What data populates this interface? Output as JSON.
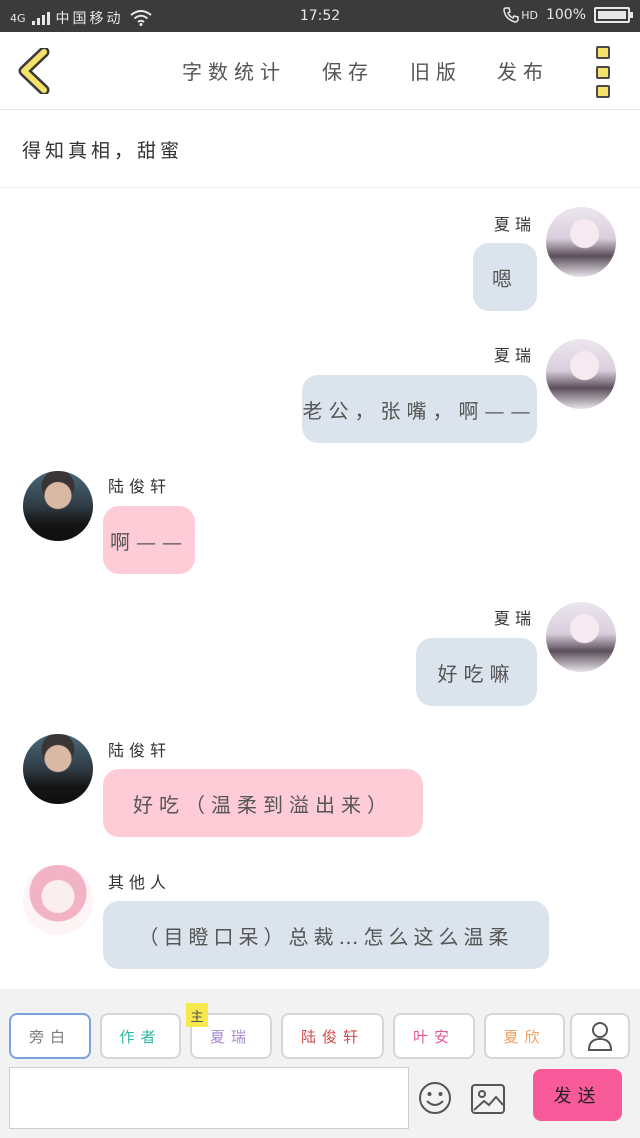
{
  "status_bar": {
    "network": "4G",
    "carrier": "中国移动",
    "time": "17:52",
    "hd": "HD",
    "battery": "100%",
    "battery_level": 1.0
  },
  "nav": {
    "word_count": "字数统计",
    "save": "保存",
    "old_version": "旧版",
    "publish": "发布"
  },
  "chapter_title": "得知真相，甜蜜",
  "messages": [
    {
      "speaker": "夏瑞",
      "side": "right",
      "text": "嗯"
    },
    {
      "speaker": "夏瑞",
      "side": "right",
      "text": "老公，张嘴，啊——"
    },
    {
      "speaker": "陆俊轩",
      "side": "left",
      "text": "啊——"
    },
    {
      "speaker": "夏瑞",
      "side": "right",
      "text": "好吃嘛"
    },
    {
      "speaker": "陆俊轩",
      "side": "left",
      "text": "好吃（温柔到溢出来）"
    },
    {
      "speaker": "其他人",
      "side": "left",
      "text": "（目瞪口呆）总裁…怎么这么温柔"
    }
  ],
  "roles": [
    {
      "label": "旁白",
      "color": "#7a7a7a"
    },
    {
      "label": "作者",
      "color": "#2fb8a6"
    },
    {
      "label": "夏瑞",
      "color": "#a88ad6"
    },
    {
      "label": "陆俊轩",
      "color": "#d54a48"
    },
    {
      "label": "叶安",
      "color": "#e35a9a"
    },
    {
      "label": "夏欣",
      "color": "#f0a060"
    }
  ],
  "main_badge": "主",
  "input": {
    "value": "",
    "placeholder": ""
  },
  "send_label": "发送",
  "icons": {
    "back": "chevron-left-icon",
    "menu": "menu-icon",
    "user": "user-icon",
    "emoji": "smiley-icon",
    "image": "image-icon"
  },
  "colors": {
    "accent_send": "#f95a9a",
    "bubble_right": "#dbe4ec",
    "bubble_left": "#fdccd6",
    "back_arrow": "#f4e26a"
  }
}
